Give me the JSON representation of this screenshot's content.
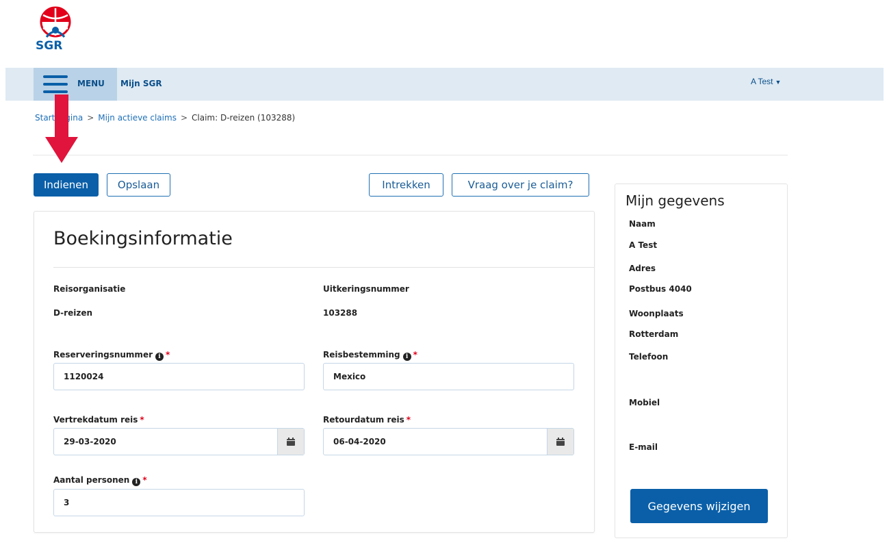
{
  "logo": {
    "text": "SGR"
  },
  "navbar": {
    "menu_label": "MENU",
    "app_link": "Mijn SGR",
    "user": "A Test"
  },
  "breadcrumb": {
    "home": "Startpagina",
    "claims": "Mijn actieve claims",
    "current": "Claim: D-reizen (103288)",
    "separator": ">"
  },
  "actions": {
    "submit": "Indienen",
    "save": "Opslaan",
    "withdraw": "Intrekken",
    "question": "Vraag over je claim?"
  },
  "booking": {
    "title": "Boekingsinformatie",
    "organisation_label": "Reisorganisatie",
    "organisation_value": "D-reizen",
    "payout_label": "Uitkeringsnummer",
    "payout_value": "103288",
    "reservation_label": "Reserveringsnummer",
    "reservation_value": "1120024",
    "destination_label": "Reisbestemming",
    "destination_value": "Mexico",
    "departure_label": "Vertrekdatum reis",
    "departure_value": "29-03-2020",
    "return_label": "Retourdatum reis",
    "return_value": "06-04-2020",
    "persons_label": "Aantal personen",
    "persons_value": "3",
    "required_mark": "*"
  },
  "profile": {
    "title": "Mijn gegevens",
    "name_label": "Naam",
    "name_value": "A Test",
    "address_label": "Adres",
    "address_value": "Postbus 4040",
    "city_label": "Woonplaats",
    "city_value": "Rotterdam",
    "phone_label": "Telefoon",
    "mobile_label": "Mobiel",
    "email_label": "E-mail",
    "edit_button": "Gegevens wijzigen"
  },
  "icons": {
    "menu": "hamburger-icon",
    "user_caret": "caret-down-icon",
    "info": "info-icon",
    "calendar": "calendar-icon",
    "annotation": "red-arrow-down-icon"
  },
  "colors": {
    "brand_blue": "#0a5fa8",
    "navbar_bg": "#dfeaf3",
    "menu_bg": "#b9d2e7",
    "required_red": "#e2001a",
    "annotation_arrow": "#e0143c"
  }
}
